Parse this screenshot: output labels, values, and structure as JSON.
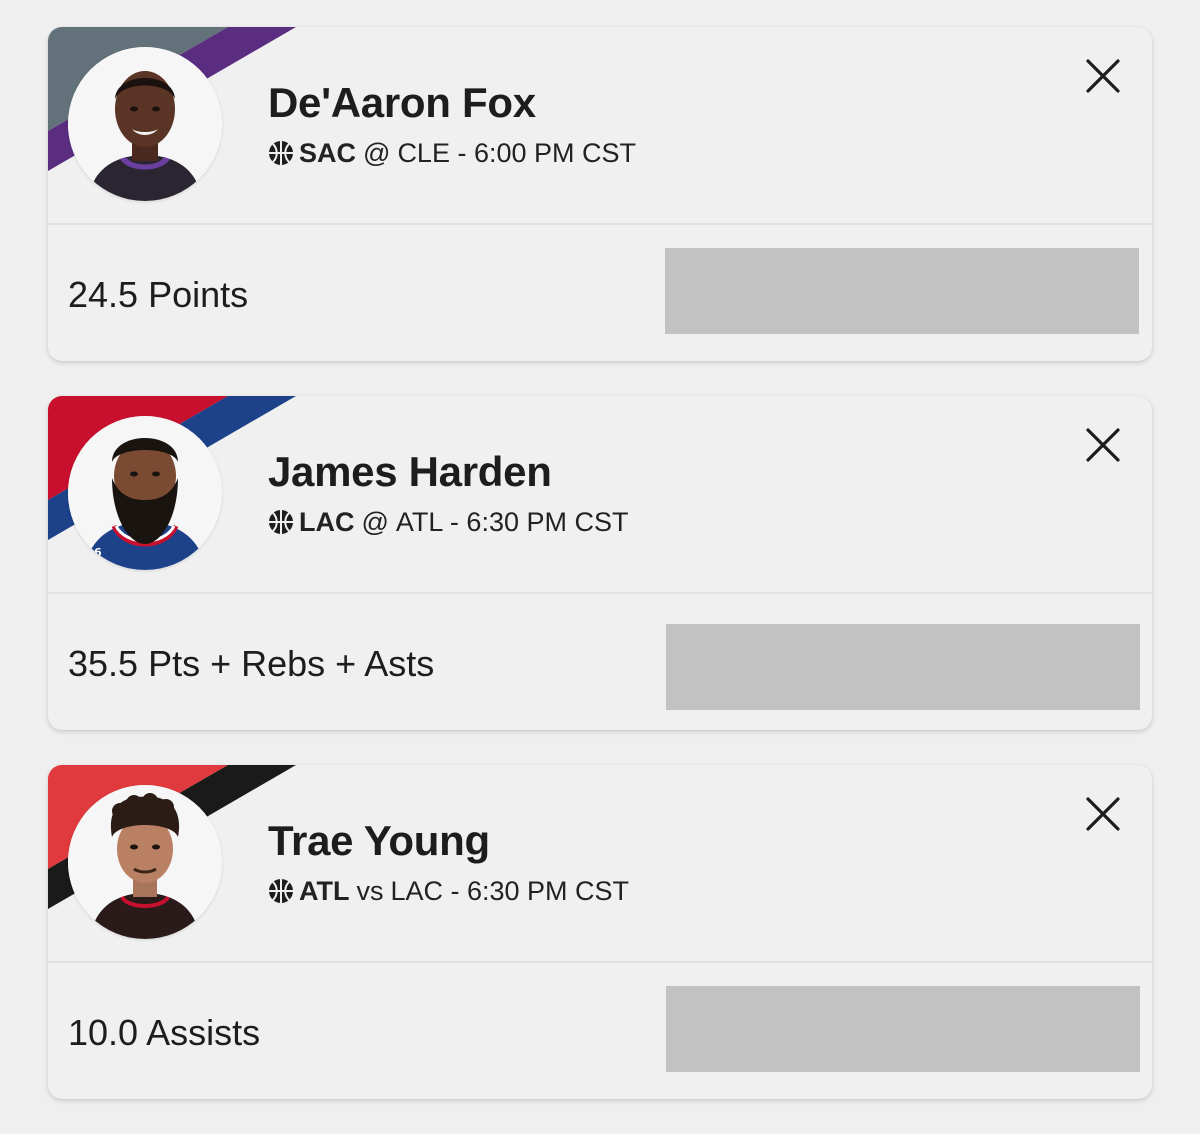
{
  "picks": [
    {
      "player_name": "De'Aaron Fox",
      "team": "SAC",
      "separator": "@",
      "opponent_time": "CLE - 6:00 PM CST",
      "stat_line": "24.5 Points",
      "team_colors": [
        "#63727a",
        "#5a2d81"
      ]
    },
    {
      "player_name": "James Harden",
      "team": "LAC",
      "separator": "@",
      "opponent_time": "ATL - 6:30 PM CST",
      "stat_line": "35.5 Pts + Rebs + Asts",
      "team_colors": [
        "#c8102e",
        "#1d428a"
      ]
    },
    {
      "player_name": "Trae Young",
      "team": "ATL",
      "separator": "vs",
      "opponent_time": "LAC - 6:30 PM CST",
      "stat_line": "10.0 Assists",
      "team_colors": [
        "#e03a3e",
        "#1a1a1a"
      ]
    }
  ],
  "icons": {
    "sport": "basketball-icon",
    "close": "close-icon"
  }
}
